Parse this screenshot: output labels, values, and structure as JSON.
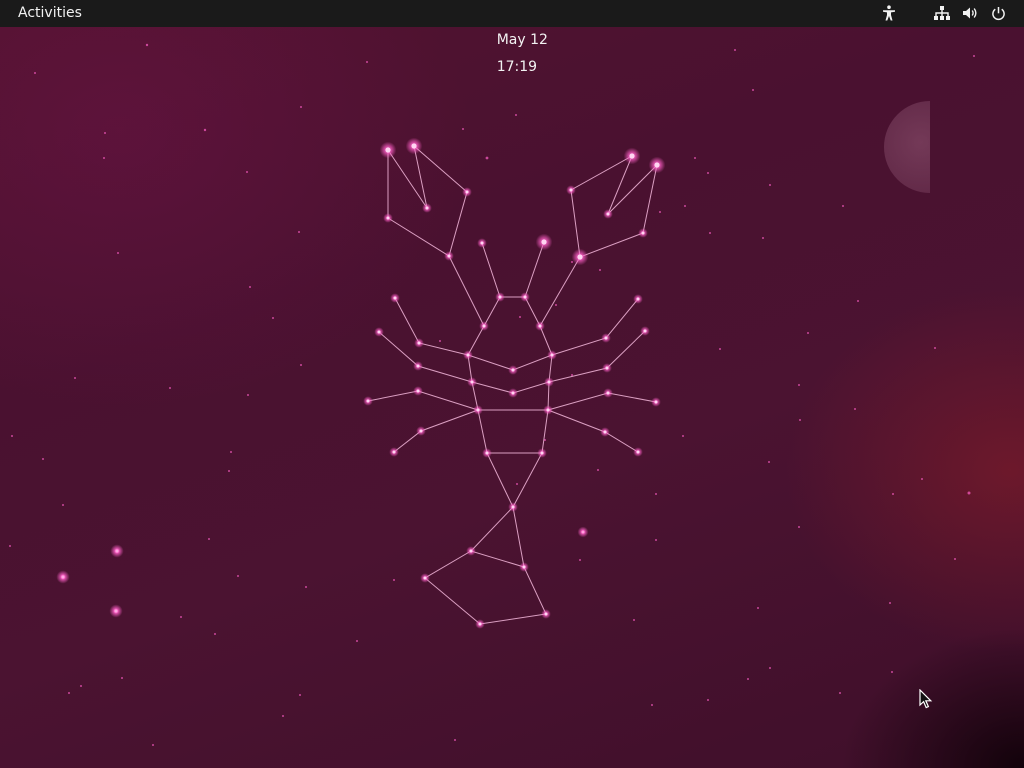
{
  "top_bar": {
    "activities_label": "Activities",
    "clock": {
      "date": "May 12",
      "time": "17:19"
    },
    "tray_icons": [
      "accessibility-icon",
      "network-icon",
      "volume-icon",
      "power-icon"
    ]
  },
  "wallpaper": {
    "theme": "lobster-constellation",
    "background_color": "#4a1130",
    "constellation_color": "#f4a6d6",
    "star_color": "#ff5fc8"
  }
}
